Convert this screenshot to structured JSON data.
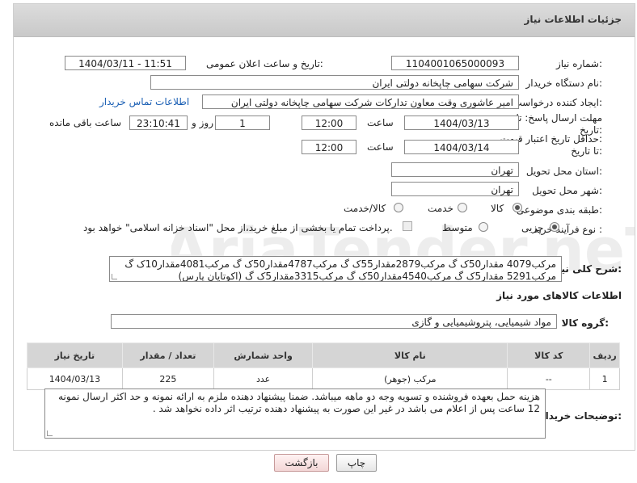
{
  "header": {
    "title": "جزئیات اطلاعات نیاز"
  },
  "form": {
    "need_number_label": "شماره نیاز:",
    "need_number": "1104001065000093",
    "announce_label": "تاریخ و ساعت اعلان عمومی:",
    "announce_value": "1404/03/11 - 11:51",
    "buyer_org_label": "نام دستگاه خریدار:",
    "buyer_org": "شرکت سهامی چاپخانه دولتی ایران",
    "creator_label": "ایجاد کننده درخواست:",
    "creator": "امیر عاشوری وقت معاون تدارکات شرکت سهامی چاپخانه دولتی ایران",
    "contact_link": "اطلاعات تماس خریدار",
    "deadline_label_1": "مهلت ارسال پاسخ: تا",
    "deadline_label_2": "تاریخ:",
    "deadline_date": "1404/03/13",
    "time_label": "ساعت",
    "deadline_time": "12:00",
    "days_value": "1",
    "days_label": "روز و",
    "remaining_time": "23:10:41",
    "remaining_label": "ساعت باقی مانده",
    "validity_label_1": "حداقل تاریخ اعتبار قیمت:",
    "validity_label_2": "تا تاریخ:",
    "validity_date": "1404/03/14",
    "validity_time": "12:00",
    "province_label": "استان محل تحویل:",
    "province": "تهران",
    "city_label": "شهر محل تحویل:",
    "city": "تهران",
    "category_label": "طبقه بندی موضوعی:",
    "category_options": [
      "کالا",
      "خدمت",
      "کالا/خدمت"
    ],
    "category_selected": "کالا",
    "process_label": "نوع فرآیند خرید :",
    "process_options": [
      "جزیی",
      "متوسط"
    ],
    "process_selected": "جزیی",
    "payment_note": "پرداخت تمام یا بخشی از مبلغ خرید،از محل \"اسناد خزانه اسلامی\" خواهد بود.",
    "general_desc_label": "شرح کلی نیاز:",
    "general_desc": "مرکب4079 مقدار50ک گ مرکب2879مقدار55ک گ مرکب4787مقدار50ک گ مرکب4081مقدار10ک گ مرکب5291 مقدار5ک گ مرکب4540مقدار50ک گ مرکب3315مقدار5ک گ (اکوتایان پارس)"
  },
  "goods": {
    "section_title": "اطلاعات کالاهای مورد نیاز",
    "group_label": "گروه کالا:",
    "group_value": "مواد شیمیایی، پتروشیمیایی و  گازی",
    "columns": [
      "ردیف",
      "کد کالا",
      "نام کالا",
      "واحد شمارش",
      "تعداد / مقدار",
      "تاریخ نیاز"
    ],
    "rows": [
      {
        "row": "1",
        "code": "--",
        "name": "مرکب (جوهر)",
        "unit": "عدد",
        "qty": "225",
        "date": "1404/03/13"
      }
    ]
  },
  "buyer_notes": {
    "label": "توضیحات خریدار:",
    "text": "هزینه حمل بعهده فروشنده و تسویه وجه دو ماهه  میباشد. ضمنا پیشنهاد دهنده ملزم به ارائه نمونه و  حد اکثر ارسال نمونه 12 ساعت پس از اعلام می باشد در غیر این صورت به پیشنهاد دهنده ترتیب  اثر داده نخواهد شد ."
  },
  "buttons": {
    "print": "چاپ",
    "back": "بازگشت"
  },
  "watermark": "AriaTender.neT",
  "colors": {
    "link": "#1a5fb4",
    "titlebar": "#d2d2d2",
    "table_header": "#d5d5d5"
  }
}
